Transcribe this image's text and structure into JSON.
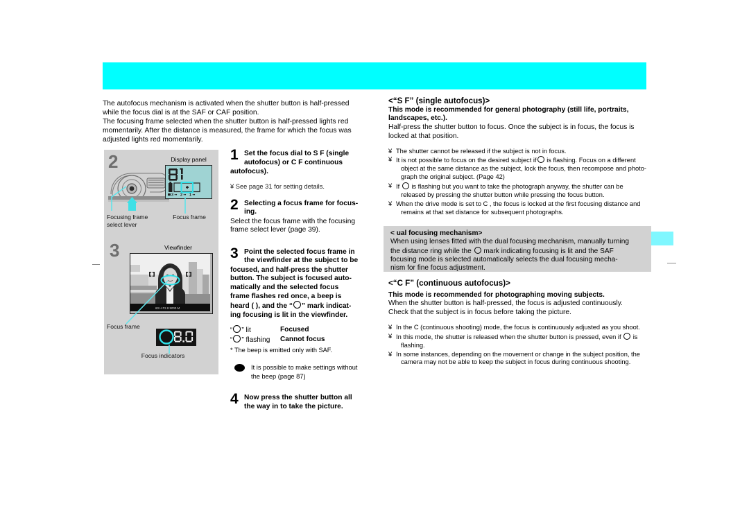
{
  "page": {
    "background": "#ffffff",
    "header_bar_color": "#00ffff",
    "edge_tab_color": "#7ff7ff",
    "panel_gray": "#d2d2d2"
  },
  "intro": {
    "line1": "The autofocus mechanism is activated when the shutter button is half-pressed",
    "line2": "while the focus dial is at the  SAF  or  CAF  position.",
    "line3": "The focusing frame selected when the shutter button is half-pressed lights red",
    "line4": "momentarily. After the distance is measured, the frame for which the focus was",
    "line5": "adjusted lights red momentarily."
  },
  "figure": {
    "step2_number": "2",
    "display_panel_label": "Display panel",
    "display_panel_value": "01",
    "display_panel_scale": "3 • • 2 • • 1 • •",
    "focusing_frame_select_lever_label_l1": "Focusing frame",
    "focusing_frame_select_lever_label_l2": "select lever",
    "focus_frame_label": "Focus frame",
    "step3_number": "3",
    "viewfinder_label": "Viewfinder",
    "viewfinder_focus_frame_label": "Focus frame",
    "viewfinder_readout": "8.0",
    "focus_indicators_label": "Focus indicators",
    "viewfinder_data_strip": "60 th   F2.8  5000 M"
  },
  "steps": {
    "step1": {
      "num": "1",
      "head_l1": "Set the focus dial to  S F  (single",
      "head_l2": "autofocus) or  C F  continuous",
      "head_l3": "autofocus).",
      "note": "¥ See page 31 for setting details."
    },
    "step2": {
      "num": "2",
      "head_l1": "Selecting a focus frame for focus-",
      "head_l2": "ing.",
      "body_l1": "Select the focus frame with the focusing",
      "body_l2": "frame select lever (page 39)."
    },
    "step3": {
      "num": "3",
      "head_l1": "Point the selected focus frame in",
      "head_l2": "the viewfinder at the subject to be",
      "head_l3": "focused, and half-press the shutter",
      "head_l4": "button. The subject is focused auto-",
      "head_l5": "matically and the selected focus",
      "head_l6": "frame flashes red once, a beep is",
      "head_l7_a": "heard ( ), and the “",
      "head_l7_b": "” mark indicat-",
      "head_l8": "ing focusing is lit in the viewfinder."
    },
    "focus_table": {
      "row1_left_a": "“",
      "row1_left_b": "” lit",
      "row1_right": "Focused",
      "row2_left_a": "“",
      "row2_left_b": "” flashing",
      "row2_right": "Cannot focus",
      "beep_note": "* The beep is emitted only with SAF."
    },
    "tip": {
      "line1": "It is possible to make settings without",
      "line2": "the beep (page 87)"
    },
    "step4": {
      "num": "4",
      "head_l1": "Now press the shutter button all",
      "head_l2": "the way in to take the picture."
    }
  },
  "saf": {
    "title": "<“S  F” (single autofocus)>",
    "bold_l1": "This mode is recommended for general photography (still life, portraits,",
    "bold_l2": "landscapes, etc.).",
    "plain_l1": "Half-press the shutter button to focus. Once the subject is in focus, the focus is",
    "plain_l2": "locked at that position.",
    "bullets": [
      {
        "marker": "¥",
        "text": "The shutter cannot be released if the subject is not in focus."
      },
      {
        "marker": "¥",
        "text_a": "It is not possible to focus on the desired subject if",
        "text_b": "is flashing. Focus on a different",
        "text_c": "object at the same distance as the subject, lock the focus, then recompose and photo-",
        "text_d": "graph the original subject. (Page 42)"
      },
      {
        "marker": "¥",
        "text_a": "If",
        "text_b": "is flashing but you want to take the photograph anyway, the shutter can be",
        "text_c": "released by pressing the shutter button while pressing the focus button."
      },
      {
        "marker": "¥",
        "text_a": "When the drive mode is set to  C , the focus is locked at the first focusing distance and",
        "text_b": "remains at that set distance for subsequent photographs."
      }
    ]
  },
  "dual": {
    "title": "<  ual focusing mechanism>",
    "l1": "When using lenses fitted with the dual focusing mechanism, manually turning",
    "l2_a": "the distance ring while the",
    "l2_b": "mark indicating focusing is lit and the SAF",
    "l3": "focusing mode is selected automatically selects the dual focusing mecha-",
    "l4": "nism for fine focus adjustment."
  },
  "caf": {
    "title": "<“C  F” (continuous autofocus)>",
    "bold_l1": "This mode is recommended for photographing moving subjects.",
    "plain_l1": "When the shutter button is half-pressed, the focus is adjusted continuously.",
    "plain_l2": "Check that the subject is in focus before taking the picture.",
    "bullets": [
      {
        "marker": "¥",
        "text": "In the  C  (continuous shooting) mode, the focus is continuously adjusted as you shoot."
      },
      {
        "marker": "¥",
        "text_a": "In this mode, the shutter is released when the shutter button is pressed, even if",
        "text_b": "is",
        "text_c": "flashing."
      },
      {
        "marker": "¥",
        "text_a": "In some instances, depending on the movement or change in the subject position, the",
        "text_b": "camera may not be able to keep the subject in focus during continuous shooting."
      }
    ]
  }
}
